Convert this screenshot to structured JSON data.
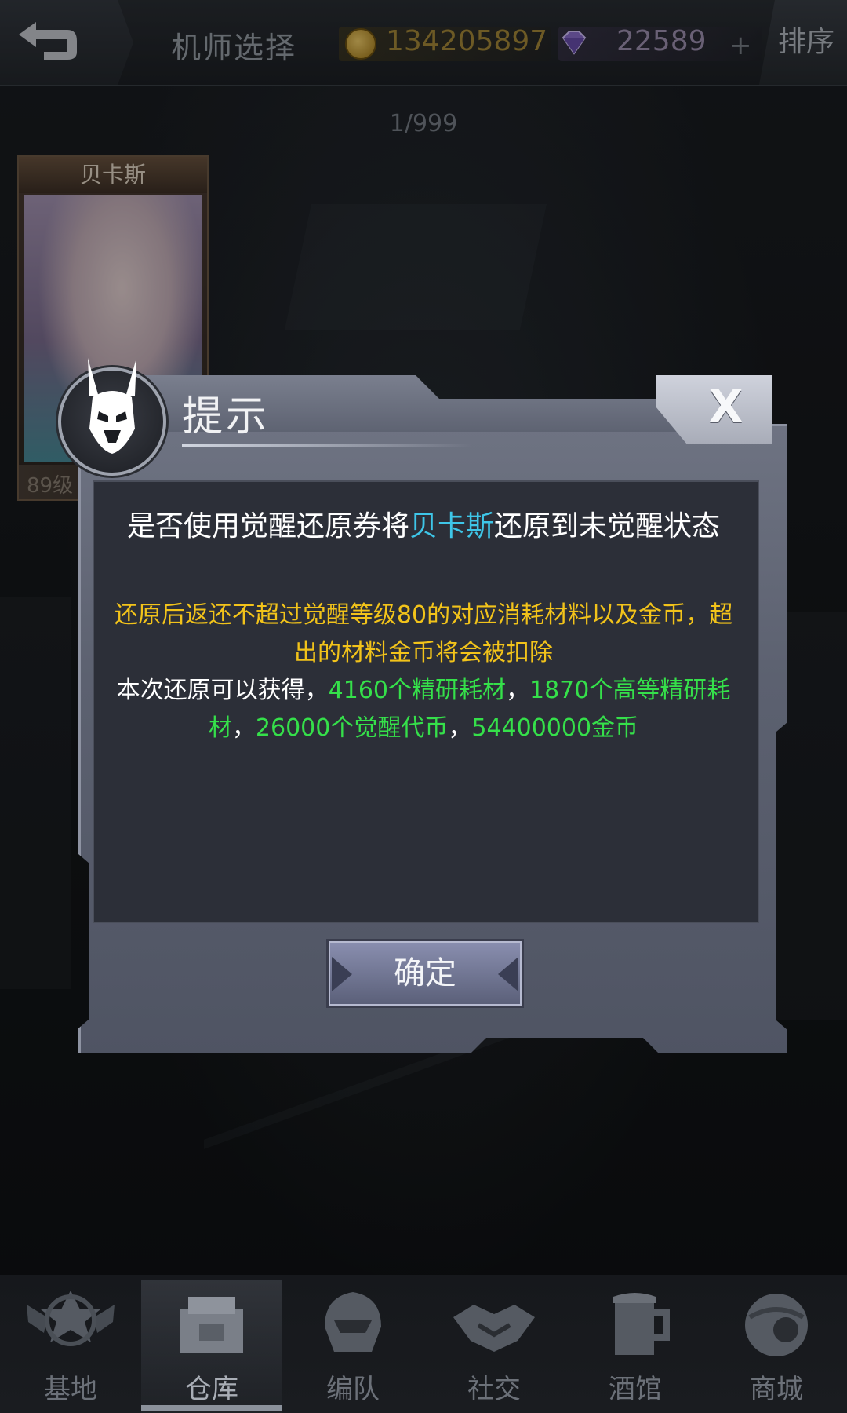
{
  "topbar": {
    "title": "机师选择",
    "coins": "134205897",
    "gems": "22589",
    "plus": "+",
    "sort_label": "排序"
  },
  "counter": "1/999",
  "pilot_card": {
    "name": "贝卡斯",
    "level": "89级"
  },
  "dialog": {
    "title": "提示",
    "close": "X",
    "message_part1": "是否使用觉醒还原券将",
    "message_name": "贝卡斯",
    "message_part2": "还原到未觉醒状态",
    "warning": "还原后返还不超过觉醒等级80的对应消耗材料以及金币，超出的材料金币将会被扣除",
    "reward_intro": "本次还原可以获得，",
    "reward_1": "4160个精研耗材",
    "sep_1": "，",
    "reward_2": "1870个高等精研耗材",
    "sep_2": "，",
    "reward_3": "26000个觉醒代币",
    "sep_3": "，",
    "reward_4": "54400000金币",
    "confirm_label": "确定"
  },
  "bottom_nav": [
    {
      "label": "基地",
      "icon": "base-emblem-icon"
    },
    {
      "label": "仓库",
      "icon": "warehouse-icon"
    },
    {
      "label": "编队",
      "icon": "helmet-icon"
    },
    {
      "label": "社交",
      "icon": "handshake-icon"
    },
    {
      "label": "酒馆",
      "icon": "beer-mug-icon"
    },
    {
      "label": "商城",
      "icon": "shop-orb-icon"
    }
  ],
  "colors": {
    "highlight_name": "#3ec6e8",
    "warning_text": "#f2c31a",
    "reward_green": "#35e04a",
    "coin_text": "#a88a3a"
  }
}
